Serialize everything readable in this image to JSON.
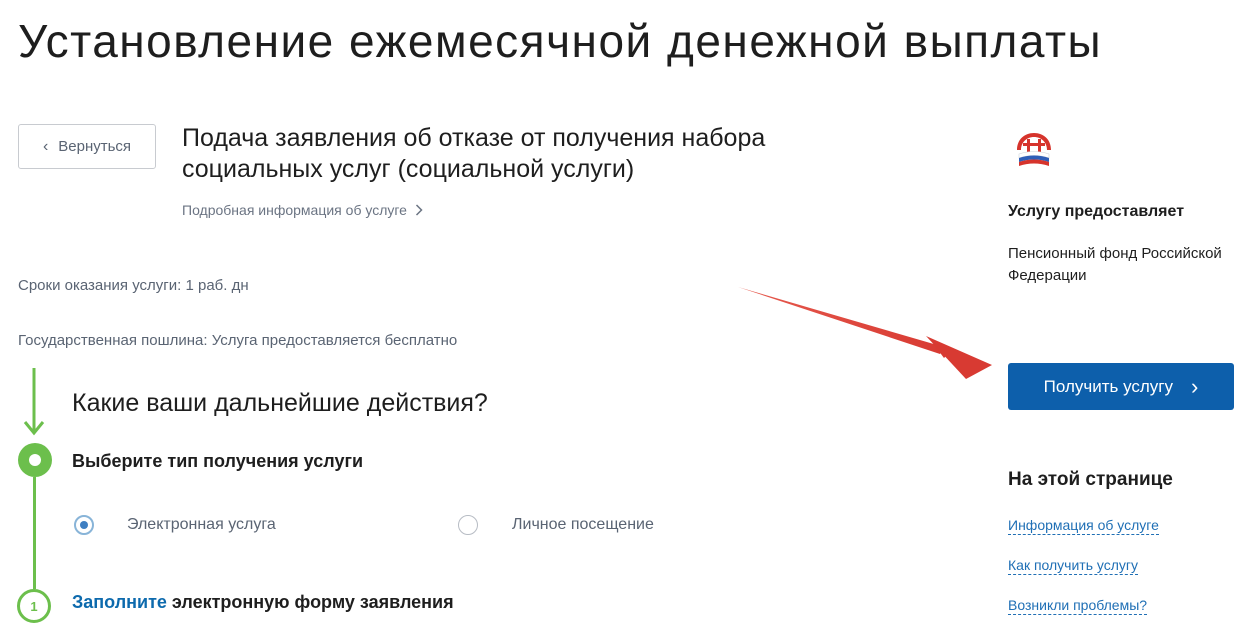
{
  "page": {
    "title": "Установление ежемесячной денежной выплаты"
  },
  "service": {
    "back_label": "Вернуться",
    "name": "Подача заявления об отказе от получения набора социальных услуг (социальной услуги)",
    "more_info_label": "Подробная информация об услуге",
    "terms": "Сроки оказания услуги: 1 раб. дн",
    "fee": "Государственная пошлина: Услуга предоставляется бесплатно"
  },
  "steps": {
    "heading": "Какие ваши дальнейшие действия?",
    "choose_type_title": "Выберите тип получения услуги",
    "options": [
      {
        "label": "Электронная услуга",
        "selected": true
      },
      {
        "label": "Личное посещение",
        "selected": false
      }
    ],
    "step_number": "1",
    "fill_link": "Заполните",
    "fill_rest": " электронную форму заявления"
  },
  "sidebar": {
    "logo_icon": "pfr-logo-icon",
    "provider_caption": "Услугу предоставляет",
    "provider_name": "Пенсионный фонд Российской Федерации",
    "get_service_label": "Получить услугу",
    "on_this_page": "На этой странице",
    "links": [
      "Информация об услуге",
      "Как получить услугу",
      "Возникли проблемы?"
    ]
  },
  "colors": {
    "primary_button": "#0d5fab",
    "step_green": "#6cbf4c",
    "link_blue": "#1f6fb5",
    "annotation_arrow": "#e0403a"
  }
}
